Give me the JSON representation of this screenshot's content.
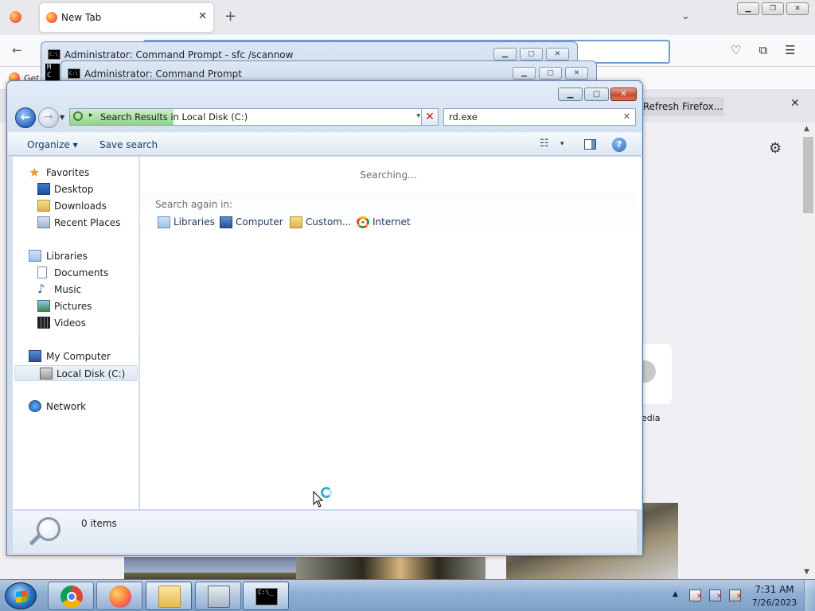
{
  "firefox": {
    "tab_title": "New Tab",
    "tab_close": "✕",
    "new_tab": "+",
    "list_tabs": "⌄",
    "back": "←",
    "bookmark_text": "Get",
    "refresh_button": "Refresh Firefox...",
    "notification_close": "✕",
    "settings_icon": "gear-icon",
    "tile_label": "edia"
  },
  "cmd_windows": [
    {
      "title": "Administrator:  Command Prompt - sfc  /scannow"
    },
    {
      "title": "Administrator:  Command Prompt"
    }
  ],
  "explorer": {
    "address": {
      "arrow": "▸",
      "text": "Search Results in Local Disk (C:)",
      "dropdown": "▾"
    },
    "stop_button": "✕",
    "search_box": {
      "value": "rd.exe",
      "clear": "✕"
    },
    "toolbar": {
      "organize_label": "Organize ▾",
      "save_search_label": "Save search",
      "views_dropdown": "▾",
      "help": "?"
    },
    "nav": {
      "favorites": "Favorites",
      "desktop": "Desktop",
      "downloads": "Downloads",
      "recent_places": "Recent Places",
      "libraries": "Libraries",
      "documents": "Documents",
      "music": "Music",
      "pictures": "Pictures",
      "videos": "Videos",
      "my_computer": "My Computer",
      "local_disk": "Local Disk (C:)",
      "network": "Network"
    },
    "content": {
      "status": "Searching...",
      "search_again_label": "Search again in:",
      "search_again_items": {
        "libraries": "Libraries",
        "computer": "Computer",
        "custom": "Custom...",
        "internet": "Internet"
      }
    },
    "details": {
      "item_count": "0 items"
    }
  },
  "taskbar": {
    "clock_time": "7:31 AM",
    "clock_date": "7/26/2023",
    "cmd_icon_text": "C:\\_",
    "tray_expand": "▲"
  }
}
